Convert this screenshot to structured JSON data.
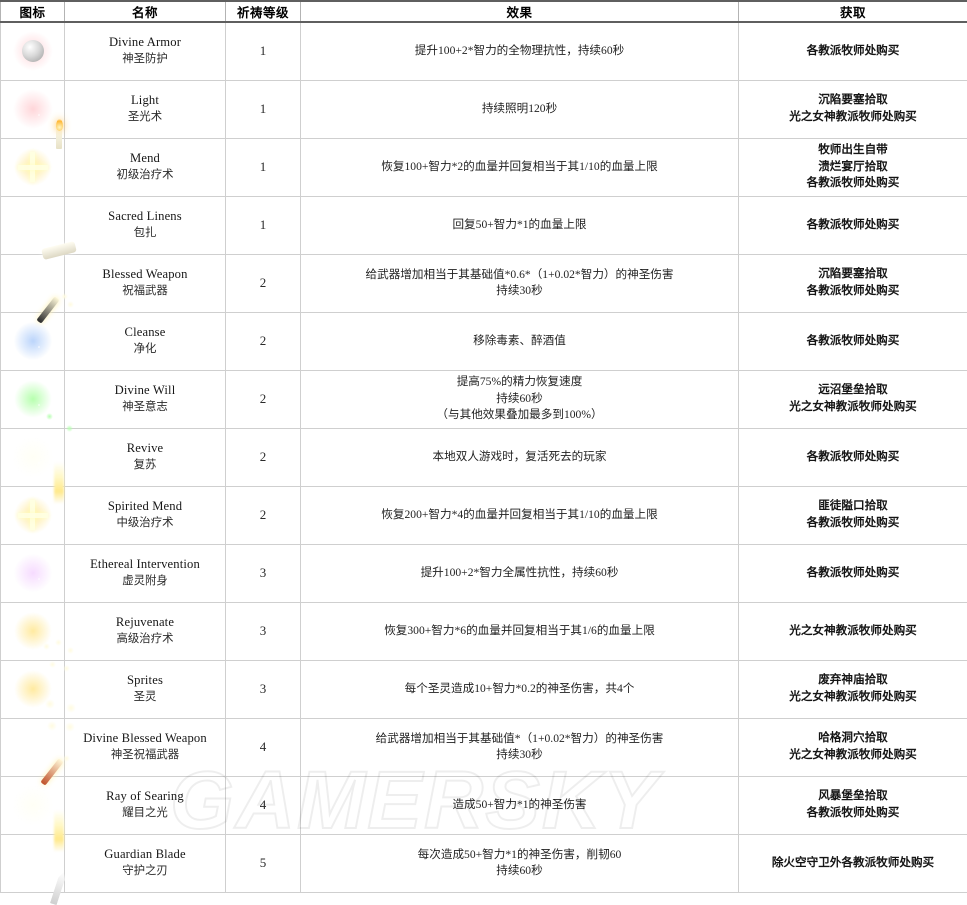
{
  "table": {
    "headers": [
      "图标",
      "名称",
      "祈祷等级",
      "效果",
      "获取"
    ],
    "watermark": "GAMERSKY",
    "rows": [
      {
        "icon": "divine-armor-icon",
        "name_en": "Divine Armor",
        "name_cn": "神圣防护",
        "level": "1",
        "effect": [
          "提升100+2*智力的全物理抗性，持续60秒"
        ],
        "acquire": [
          "各教派牧师处购买"
        ]
      },
      {
        "icon": "light-icon",
        "name_en": "Light",
        "name_cn": "圣光术",
        "level": "1",
        "effect": [
          "持续照明120秒"
        ],
        "acquire": [
          "沉陷要塞拾取",
          "光之女神教派牧师处购买"
        ]
      },
      {
        "icon": "mend-icon",
        "name_en": "Mend",
        "name_cn": "初级治疗术",
        "level": "1",
        "effect": [
          "恢复100+智力*2的血量并回复相当于其1/10的血量上限"
        ],
        "acquire": [
          "牧师出生自带",
          "溃烂宴厅拾取",
          "各教派牧师处购买"
        ]
      },
      {
        "icon": "sacred-linens-icon",
        "name_en": "Sacred Linens",
        "name_cn": "包扎",
        "level": "1",
        "effect": [
          "回复50+智力*1的血量上限"
        ],
        "acquire": [
          "各教派牧师处购买"
        ]
      },
      {
        "icon": "blessed-weapon-icon",
        "name_en": "Blessed Weapon",
        "name_cn": "祝福武器",
        "level": "2",
        "effect": [
          "给武器增加相当于其基础值*0.6*（1+0.02*智力）的神圣伤害",
          "持续30秒"
        ],
        "acquire": [
          "沉陷要塞拾取",
          "各教派牧师处购买"
        ]
      },
      {
        "icon": "cleanse-icon",
        "name_en": "Cleanse",
        "name_cn": "净化",
        "level": "2",
        "effect": [
          "移除毒素、醉酒值"
        ],
        "acquire": [
          "各教派牧师处购买"
        ]
      },
      {
        "icon": "divine-will-icon",
        "name_en": "Divine Will",
        "name_cn": "神圣意志",
        "level": "2",
        "effect": [
          "提高75%的精力恢复速度",
          "持续60秒",
          "（与其他效果叠加最多到100%）"
        ],
        "acquire": [
          "远沼堡垒拾取",
          "光之女神教派牧师处购买"
        ]
      },
      {
        "icon": "revive-icon",
        "name_en": "Revive",
        "name_cn": "复苏",
        "level": "2",
        "effect": [
          "本地双人游戏时，复活死去的玩家"
        ],
        "acquire": [
          "各教派牧师处购买"
        ]
      },
      {
        "icon": "spirited-mend-icon",
        "name_en": "Spirited Mend",
        "name_cn": "中级治疗术",
        "level": "2",
        "effect": [
          "恢复200+智力*4的血量并回复相当于其1/10的血量上限"
        ],
        "acquire": [
          "匪徒隘口拾取",
          "各教派牧师处购买"
        ]
      },
      {
        "icon": "ethereal-intervention-icon",
        "name_en": "Ethereal Intervention",
        "name_cn": "虚灵附身",
        "level": "3",
        "effect": [
          "提升100+2*智力全属性抗性，持续60秒"
        ],
        "acquire": [
          "各教派牧师处购买"
        ]
      },
      {
        "icon": "rejuvenate-icon",
        "name_en": "Rejuvenate",
        "name_cn": "高级治疗术",
        "level": "3",
        "effect": [
          "恢复300+智力*6的血量并回复相当于其1/6的血量上限"
        ],
        "acquire": [
          "光之女神教派牧师处购买"
        ]
      },
      {
        "icon": "sprites-icon",
        "name_en": "Sprites",
        "name_cn": "圣灵",
        "level": "3",
        "effect": [
          "每个圣灵造成10+智力*0.2的神圣伤害，共4个"
        ],
        "acquire": [
          "废弃神庙拾取",
          "光之女神教派牧师处购买"
        ]
      },
      {
        "icon": "divine-blessed-weapon-icon",
        "name_en": "Divine Blessed Weapon",
        "name_cn": "神圣祝福武器",
        "level": "4",
        "effect": [
          "给武器增加相当于其基础值*（1+0.02*智力）的神圣伤害",
          "持续30秒"
        ],
        "acquire": [
          "哈格洞穴拾取",
          "光之女神教派牧师处购买"
        ]
      },
      {
        "icon": "ray-of-searing-icon",
        "name_en": "Ray of Searing",
        "name_cn": "耀目之光",
        "level": "4",
        "effect": [
          "造成50+智力*1的神圣伤害"
        ],
        "acquire": [
          "风暴堡垒拾取",
          "各教派牧师处购买"
        ]
      },
      {
        "icon": "guardian-blade-icon",
        "name_en": "Guardian Blade",
        "name_cn": "守护之刃",
        "level": "5",
        "effect": [
          "每次造成50+智力*1的神圣伤害，削韧60",
          "持续60秒"
        ],
        "acquire": [
          "除火空守卫外各教派牧师处购买"
        ]
      }
    ]
  }
}
